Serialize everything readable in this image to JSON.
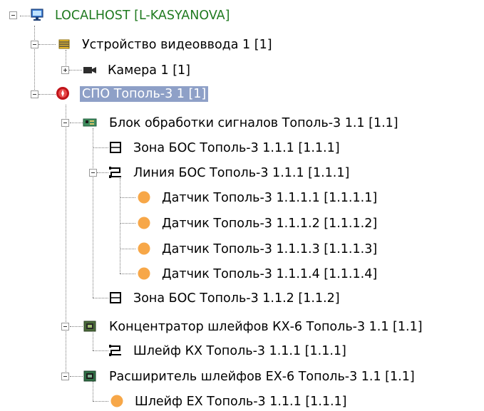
{
  "tree": {
    "root": {
      "label": "LOCALHOST [L-KASYANOVA]",
      "icon": "computer-icon"
    },
    "video_device": {
      "label": "Устройство видеоввода 1 [1]",
      "icon": "video-chip-icon"
    },
    "camera": {
      "label": "Камера 1 [1]",
      "icon": "camera-icon"
    },
    "spo": {
      "label": "СПО Тополь-3 1 [1]",
      "icon": "spo-alarm-icon",
      "selected": true
    },
    "signal_block": {
      "label": "Блок обработки сигналов Тополь-3 1.1 [1.1]",
      "icon": "circuit-board-icon"
    },
    "zone_1": {
      "label": "Зона БОС Тополь-3 1.1.1 [1.1.1]",
      "icon": "zone-icon"
    },
    "line": {
      "label": "Линия БОС Тополь-3 1.1.1 [1.1.1]",
      "icon": "line-icon"
    },
    "sensors": [
      {
        "label": "Датчик Тополь-3 1.1.1.1 [1.1.1.1]",
        "icon": "sensor-dot-icon"
      },
      {
        "label": "Датчик Тополь-3 1.1.1.2 [1.1.1.2]",
        "icon": "sensor-dot-icon"
      },
      {
        "label": "Датчик Тополь-3 1.1.1.3 [1.1.1.3]",
        "icon": "sensor-dot-icon"
      },
      {
        "label": "Датчик Тополь-3 1.1.1.4 [1.1.1.4]",
        "icon": "sensor-dot-icon"
      }
    ],
    "zone_2": {
      "label": "Зона БОС Тополь-3 1.1.2 [1.1.2]",
      "icon": "zone-icon"
    },
    "kx6": {
      "label": "Концентратор шлейфов КХ-6 Тополь-3 1.1 [1.1]",
      "icon": "hub-board-icon"
    },
    "kx_loop": {
      "label": "Шлейф КХ Тополь-3 1.1.1 [1.1.1]",
      "icon": "line-icon"
    },
    "ex6": {
      "label": "Расширитель шлейфов ЕХ-6 Тополь-3 1.1 [1.1]",
      "icon": "expander-board-icon"
    },
    "ex_loop": {
      "label": "Шлейф ЕХ Тополь-3 1.1.1 [1.1.1]",
      "icon": "sensor-dot-icon"
    }
  },
  "colors": {
    "selection": "#8ea0c7",
    "root_text": "#1f7a1f",
    "sensor": "#f7a748",
    "board": "#3f8f5f"
  }
}
